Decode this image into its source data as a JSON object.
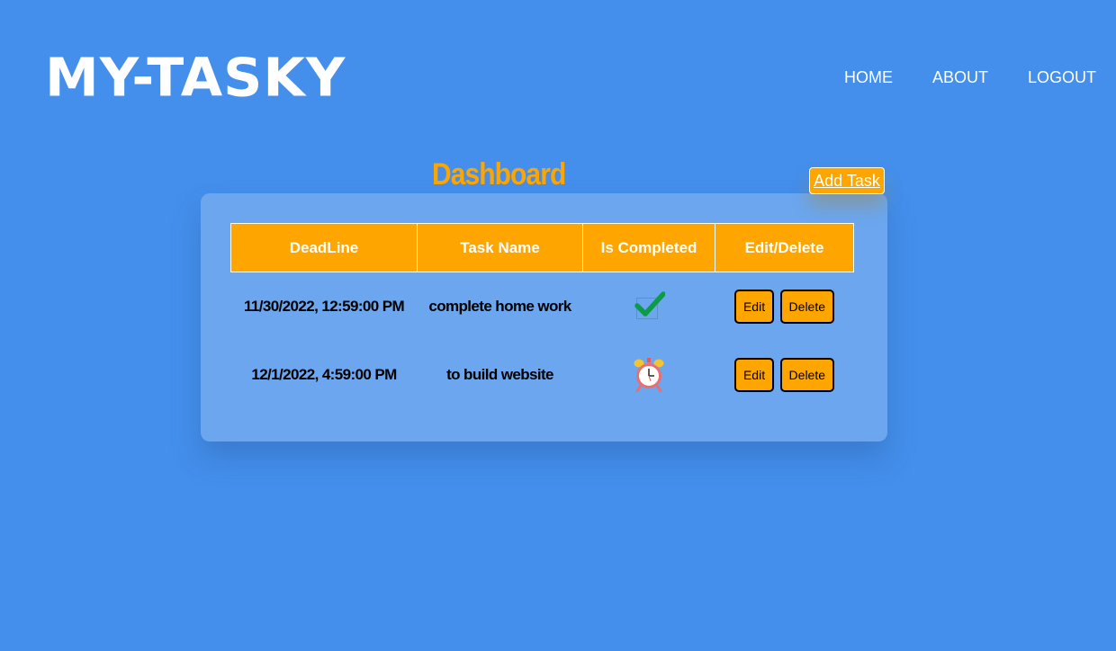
{
  "header": {
    "logo": "MY-TASKY",
    "nav": [
      "HOME",
      "ABOUT",
      "LOGOUT"
    ]
  },
  "dashboard": {
    "title": "Dashboard",
    "add_task_label": "Add Task"
  },
  "table": {
    "columns": [
      "DeadLine",
      "Task Name",
      "Is Completed",
      "Edit/Delete"
    ],
    "rows": [
      {
        "deadline": "11/30/2022, 12:59:00 PM",
        "task_name": "complete home work",
        "status_icon": "checkmark-icon",
        "edit_label": "Edit",
        "delete_label": "Delete"
      },
      {
        "deadline": "12/1/2022, 4:59:00 PM",
        "task_name": "to build website",
        "status_icon": "alarm-clock-icon",
        "edit_label": "Edit",
        "delete_label": "Delete"
      }
    ]
  },
  "colors": {
    "background": "#448feb",
    "card": "#6ba6ef",
    "accent": "#ffa500",
    "check": "#0c9b46"
  }
}
